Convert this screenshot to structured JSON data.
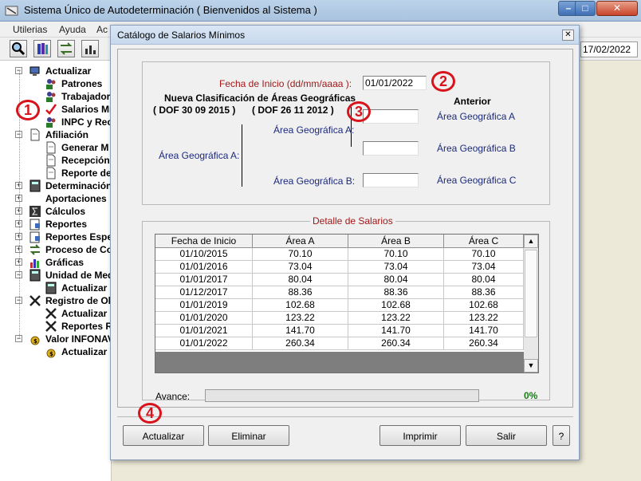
{
  "main_window": {
    "title": "Sistema Único de Autodeterminación ( Bienvenidos al Sistema )",
    "controls": {
      "minimize": "–",
      "maximize": "□",
      "close": "✕"
    },
    "menu": [
      "Utilerias",
      "Ayuda",
      "Ac"
    ],
    "date": "17/02/2022"
  },
  "tree": {
    "items": [
      {
        "label": "Actualizar",
        "level": 0,
        "icon": "computer-icon"
      },
      {
        "label": "Patrones",
        "level": 1,
        "icon": "people-icon"
      },
      {
        "label": "Trabajador",
        "level": 1,
        "icon": "people-icon"
      },
      {
        "label": "Salarios Mí",
        "level": 1,
        "icon": "checkmark-icon"
      },
      {
        "label": "INPC y Reca",
        "level": 1,
        "icon": "people-icon"
      },
      {
        "label": "Afiliación",
        "level": 0,
        "icon": "document-icon"
      },
      {
        "label": "Generar M",
        "level": 1,
        "icon": "document-icon"
      },
      {
        "label": "Recepción",
        "level": 1,
        "icon": "document-icon"
      },
      {
        "label": "Reporte de",
        "level": 1,
        "icon": "document-icon"
      },
      {
        "label": "Determinación",
        "level": 0,
        "icon": "calculator-icon"
      },
      {
        "label": "Aportaciones",
        "level": 0,
        "icon": "blank-icon"
      },
      {
        "label": "Cálculos",
        "level": 0,
        "icon": "sigma-icon"
      },
      {
        "label": "Reportes",
        "level": 0,
        "icon": "report-icon"
      },
      {
        "label": "Reportes Espe",
        "level": 0,
        "icon": "report-icon"
      },
      {
        "label": "Proceso de Co",
        "level": 0,
        "icon": "process-icon"
      },
      {
        "label": "Gráficas",
        "level": 0,
        "icon": "bar-chart-icon"
      },
      {
        "label": "Unidad de Med",
        "level": 0,
        "icon": "calculator-icon"
      },
      {
        "label": "Actualizar U",
        "level": 1,
        "icon": "calculator-icon"
      },
      {
        "label": "Registro de Ob",
        "level": 0,
        "icon": "tools-icon"
      },
      {
        "label": "Actualizar R",
        "level": 1,
        "icon": "tools-icon"
      },
      {
        "label": "Reportes R",
        "level": 1,
        "icon": "tools-icon"
      },
      {
        "label": "Valor INFONAV",
        "level": 0,
        "icon": "money-bag-icon"
      },
      {
        "label": "Actualizar V",
        "level": 1,
        "icon": "money-bag-icon"
      }
    ]
  },
  "dialog": {
    "title": "Catálogo de Salarios Mínimos",
    "close": "✕",
    "fecha_label": "Fecha de Inicio (dd/mm/aaaa ):",
    "fecha_value": "01/01/2022",
    "nueva_heading": "Nueva Clasificación de Áreas Geográficas",
    "dof_2015": "( DOF 30 09 2015 )",
    "dof_2012": "( DOF 26 11 2012 )",
    "anterior": "Anterior",
    "area_a_left": "Área Geográfica A:",
    "area_a_mid": "Área Geográfica A:",
    "area_b_mid": "Área Geográfica B:",
    "area_a_right": "Área Geográfica A",
    "area_b_right": "Área Geográfica B",
    "area_c_right": "Área Geográfica C",
    "field_values": {
      "area_a": "",
      "field_2": "",
      "area_b": ""
    },
    "detail_title": "Detalle de Salarios",
    "columns": [
      "Fecha de Inicio",
      "Área A",
      "Área B",
      "Área C"
    ],
    "rows": [
      [
        "01/10/2015",
        "70.10",
        "70.10",
        "70.10"
      ],
      [
        "01/01/2016",
        "73.04",
        "73.04",
        "73.04"
      ],
      [
        "01/01/2017",
        "80.04",
        "80.04",
        "80.04"
      ],
      [
        "01/12/2017",
        "88.36",
        "88.36",
        "88.36"
      ],
      [
        "01/01/2019",
        "102.68",
        "102.68",
        "102.68"
      ],
      [
        "01/01/2020",
        "123.22",
        "123.22",
        "123.22"
      ],
      [
        "01/01/2021",
        "141.70",
        "141.70",
        "141.70"
      ],
      [
        "01/01/2022",
        "260.34",
        "260.34",
        "260.34"
      ]
    ],
    "scroll_up": "▲",
    "scroll_down": "▼",
    "avance_label": "Avance:",
    "progress": 0,
    "progress_text": "0%",
    "buttons": {
      "actualizar": "Actualizar",
      "eliminar": "Eliminar",
      "imprimir": "Imprimir",
      "salir": "Salir",
      "help": "?"
    }
  },
  "markers": [
    "1",
    "2",
    "3",
    "4"
  ]
}
